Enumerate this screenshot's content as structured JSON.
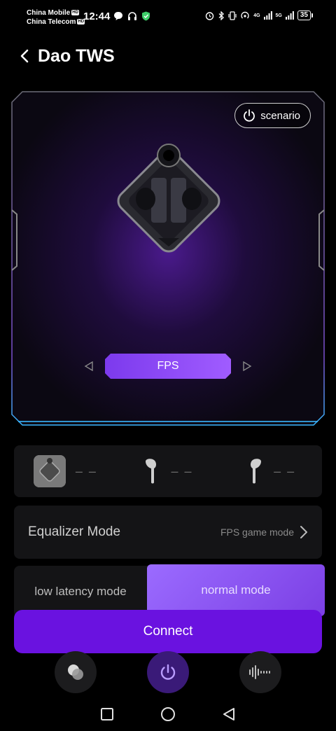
{
  "status_bar": {
    "carrier_1": "China Mobile",
    "carrier_2": "China Telecom",
    "hd_badge": "HD",
    "time": "12:44",
    "network_1": "4G",
    "network_2": "5G",
    "battery": "35"
  },
  "header": {
    "title": "Dao TWS"
  },
  "device": {
    "scenario_label": "scenario",
    "mode_label": "FPS"
  },
  "battery_levels": {
    "case": "– –",
    "left": "– –",
    "right": "– –"
  },
  "equalizer": {
    "label": "Equalizer Mode",
    "value": "FPS game mode"
  },
  "latency": {
    "low_label": "low latency mode",
    "normal_label": "normal mode",
    "selected": "normal mode"
  },
  "connect_label": "Connect",
  "colors": {
    "accent": "#6a12e0",
    "accent_light": "#9b6bff",
    "panel_glow": "#3ab7ff"
  },
  "icons": {
    "tabs": [
      "layers-icon",
      "power-icon",
      "soundwave-icon"
    ],
    "system_nav": [
      "recents-icon",
      "home-icon",
      "back-icon"
    ]
  }
}
